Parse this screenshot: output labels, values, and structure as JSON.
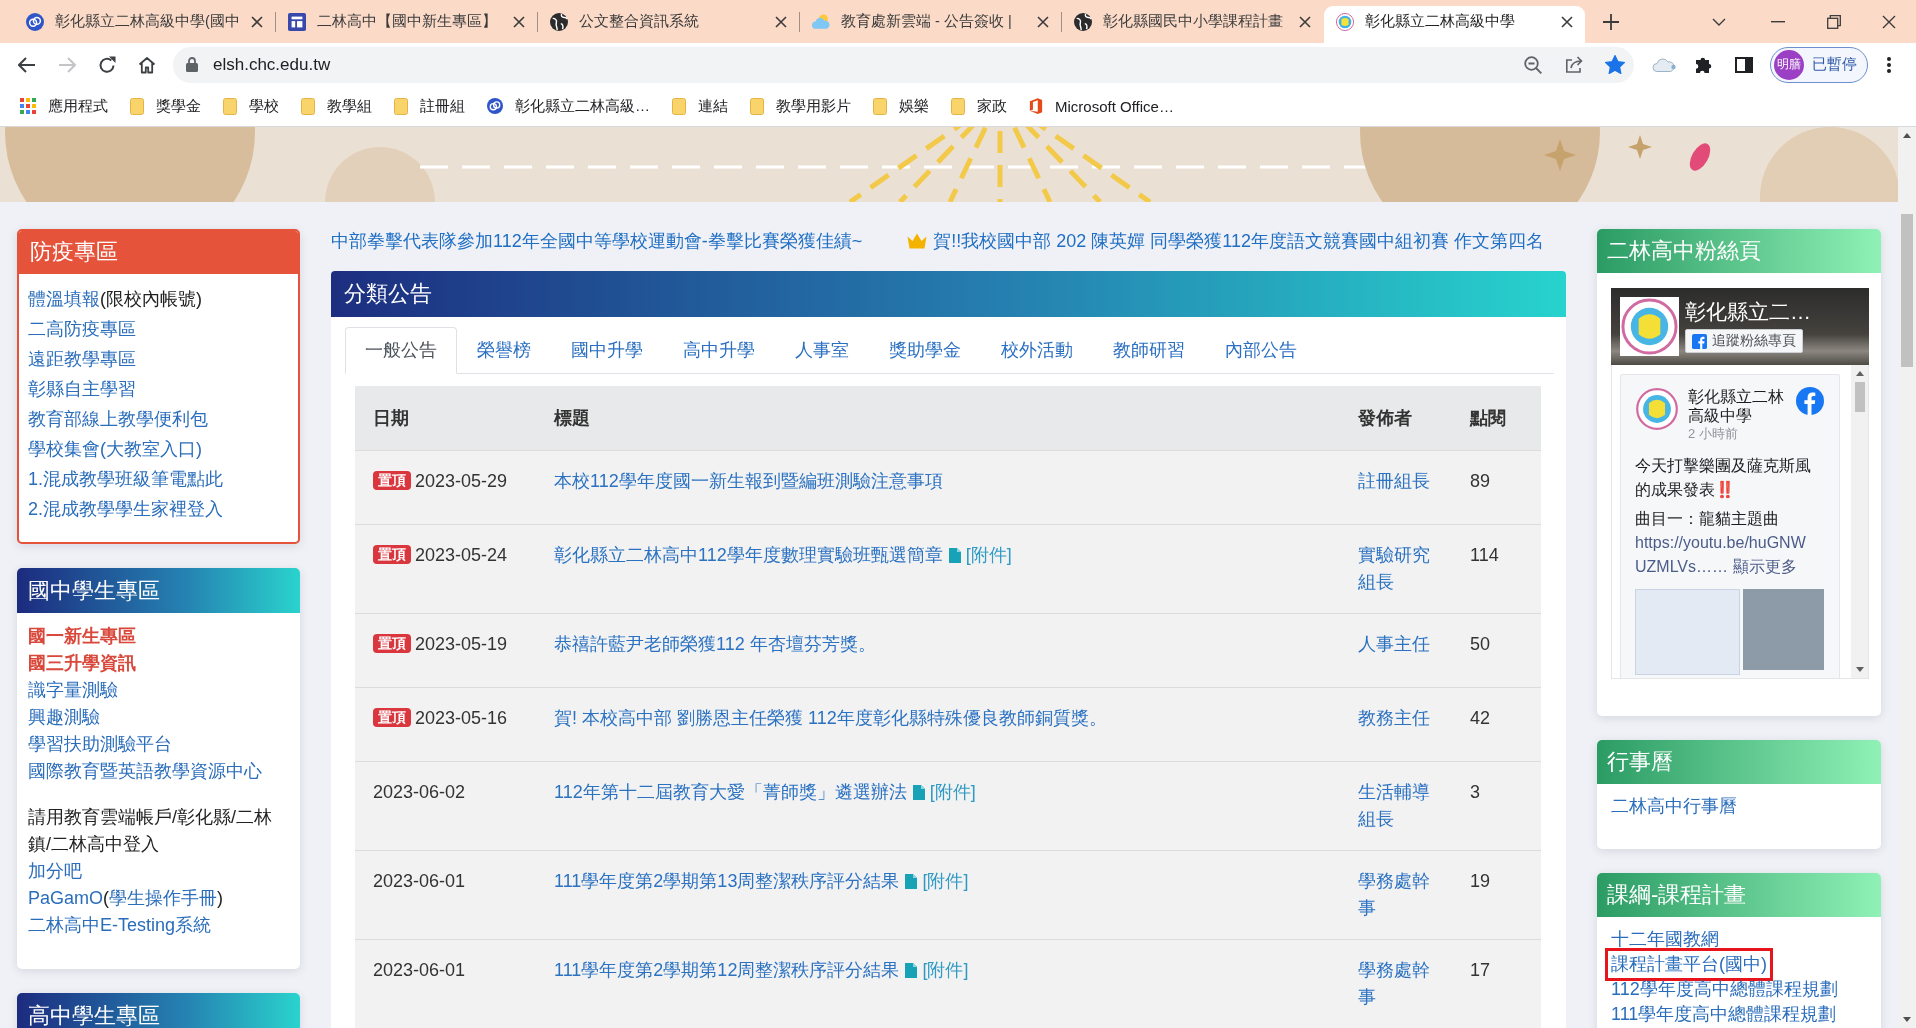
{
  "browser": {
    "tabs": [
      {
        "kind": "swirl",
        "title": "彰化縣立二林高級中學(國中",
        "selected": false
      },
      {
        "kind": "layout",
        "title": "二林高中【國中新生專區】",
        "selected": false
      },
      {
        "kind": "globe",
        "title": "公文整合資訊系統",
        "selected": false
      },
      {
        "kind": "cloud",
        "title": "教育處新雲端 - 公告簽收 |",
        "selected": false
      },
      {
        "kind": "globe",
        "title": "彰化縣國民中小學課程計畫",
        "selected": false
      },
      {
        "kind": "school",
        "title": "彰化縣立二林高級中學",
        "selected": true
      }
    ],
    "nav": [
      {
        "kind": "back",
        "disabled": false
      },
      {
        "kind": "forward",
        "disabled": true
      },
      {
        "kind": "reload",
        "disabled": false
      },
      {
        "kind": "home",
        "disabled": false
      }
    ],
    "address": {
      "url": "elsh.chc.edu.tw",
      "bookmarked": true
    },
    "profile": {
      "initials": "明膳",
      "status": "已暫停"
    },
    "bookmarks": [
      {
        "kind": "apps",
        "label": "應用程式"
      },
      {
        "kind": "folder",
        "label": "獎學金"
      },
      {
        "kind": "folder",
        "label": "學校"
      },
      {
        "kind": "folder",
        "label": "教學組"
      },
      {
        "kind": "folder",
        "label": "註冊組"
      },
      {
        "kind": "swirl",
        "label": "彰化縣立二林高級…"
      },
      {
        "kind": "folder",
        "label": "連結"
      },
      {
        "kind": "folder",
        "label": "教學用影片"
      },
      {
        "kind": "folder",
        "label": "娛樂"
      },
      {
        "kind": "folder",
        "label": "家政"
      },
      {
        "kind": "office",
        "label": "Microsoft Office…"
      }
    ]
  },
  "left_sidebar": [
    {
      "kind": "alert",
      "title": "防疫專區",
      "items": [
        {
          "kind": "mixed",
          "parts": [
            {
              "text": "體溫填報",
              "link": true
            },
            {
              "text": "(限校內帳號)",
              "link": false
            }
          ]
        },
        {
          "kind": "link",
          "text": "二高防疫專區"
        },
        {
          "kind": "link",
          "text": "遠距教學專區"
        },
        {
          "kind": "link",
          "text": "彰縣自主學習"
        },
        {
          "kind": "link",
          "text": "教育部線上教學便利包"
        },
        {
          "kind": "link",
          "text": "學校集會(大教室入口)"
        },
        {
          "kind": "link",
          "text": "1.混成教學班級筆電點此"
        },
        {
          "kind": "link",
          "text": "2.混成教學學生家裡登入"
        }
      ]
    },
    {
      "kind": "ocean",
      "title": "國中學生專區",
      "items": [
        {
          "kind": "featured",
          "text": "國一新生專區"
        },
        {
          "kind": "featured",
          "text": "國三升學資訊"
        },
        {
          "kind": "link",
          "text": "識字量測驗"
        },
        {
          "kind": "link",
          "text": "興趣測驗"
        },
        {
          "kind": "link",
          "text": "學習扶助測驗平台"
        },
        {
          "kind": "link",
          "text": "國際教育暨英語教學資源中心"
        },
        {
          "kind": "note",
          "text": "請用教育雲端帳戶/彰化縣/二林鎮/二林高中登入"
        },
        {
          "kind": "link",
          "text": "加分吧"
        },
        {
          "kind": "mixed",
          "parts": [
            {
              "text": "PaGamO",
              "link": true
            },
            {
              "text": "(",
              "link": false
            },
            {
              "text": "學生操作手冊",
              "link": true
            },
            {
              "text": ")",
              "link": false
            }
          ]
        },
        {
          "kind": "link",
          "text": "二林高中E-Testing系統"
        }
      ]
    },
    {
      "kind": "ocean",
      "title": "高中學生專區"
    }
  ],
  "ticker": [
    {
      "text": "中部拳擊代表隊參加112年全國中等學校運動會-拳擊比賽榮獲佳績~",
      "crowned": false
    },
    {
      "text": "賀!!我校國中部 202 陳英嬋 同學榮獲112年度語文競賽國中組初賽 作文第四名",
      "crowned": true
    }
  ],
  "panel": {
    "title": "分類公告",
    "tabs": [
      {
        "label": "一般公告",
        "selected": true
      },
      {
        "label": "榮譽榜",
        "selected": false
      },
      {
        "label": "國中升學",
        "selected": false
      },
      {
        "label": "高中升學",
        "selected": false
      },
      {
        "label": "人事室",
        "selected": false
      },
      {
        "label": "獎助學金",
        "selected": false
      },
      {
        "label": "校外活動",
        "selected": false
      },
      {
        "label": "教師研習",
        "selected": false
      },
      {
        "label": "內部公告",
        "selected": false
      }
    ],
    "table": {
      "columns": [
        "日期",
        "標題",
        "發佈者",
        "點閱"
      ],
      "rows": [
        {
          "badge": "置頂",
          "date": "2023-05-29",
          "title": "本校112學年度國一新生報到暨編班測驗注意事項",
          "publisher": "註冊組長",
          "views": "89"
        },
        {
          "badge": "置頂",
          "date": "2023-05-24",
          "title": "彰化縣立二林高中112學年度數理實驗班甄選簡章",
          "attachment": "[附件]",
          "publisher": "實驗研究組長",
          "views": "114"
        },
        {
          "badge": "置頂",
          "date": "2023-05-19",
          "title": "恭禧許藍尹老師榮獲112 年杏壇芬芳獎。",
          "publisher": "人事主任",
          "views": "50"
        },
        {
          "badge": "置頂",
          "date": "2023-05-16",
          "title": "賀! 本校高中部 劉勝恩主任榮獲 112年度彰化縣特殊優良教師銅質獎。",
          "publisher": "教務主任",
          "views": "42"
        },
        {
          "date": "2023-06-02",
          "title": "112年第十二屆教育大愛「菁師獎」遴選辦法",
          "attachment": "[附件]",
          "publisher": "生活輔導組長",
          "views": "3"
        },
        {
          "date": "2023-06-01",
          "title": "111學年度第2學期第13周整潔秩序評分結果",
          "attachment": "[附件]",
          "publisher": "學務處幹事",
          "views": "19"
        },
        {
          "date": "2023-06-01",
          "title": "111學年度第2學期第12周整潔秩序評分結果",
          "attachment": "[附件]",
          "publisher": "學務處幹事",
          "views": "17"
        }
      ]
    }
  },
  "right_sidebar": [
    {
      "kind": "mint",
      "title": "二林高中粉絲頁",
      "facebook": {
        "page_name": "彰化縣立二…",
        "follow": "追蹤粉絲專頁",
        "post": {
          "author": "彰化縣立二林高級中學",
          "time": "2 小時前",
          "text": "今天打擊樂團及薩克斯風的成果發表‼️",
          "tracks": "曲目一：龍貓主題曲",
          "link_lines": [
            "https://youtu.be/huGNW",
            "UZMLVs……"
          ],
          "more": "顯示更多",
          "images": [
            {
              "kind": "poster"
            },
            {
              "kind": "photo"
            }
          ]
        }
      }
    },
    {
      "kind": "mint",
      "title": "行事曆",
      "items": [
        {
          "kind": "link",
          "text": "二林高中行事曆",
          "highlighted": false
        }
      ]
    },
    {
      "kind": "mint",
      "title": "課綱-課程計畫",
      "items": [
        {
          "kind": "link",
          "text": "十二年國教網",
          "highlighted": false
        },
        {
          "kind": "link",
          "text": "課程計畫平台(國中)",
          "highlighted": true
        },
        {
          "kind": "link",
          "text": "112學年度高中總體課程規劃",
          "highlighted": false
        },
        {
          "kind": "link",
          "text": "111學年度高中總體課程規劃",
          "highlighted": false
        }
      ]
    }
  ]
}
